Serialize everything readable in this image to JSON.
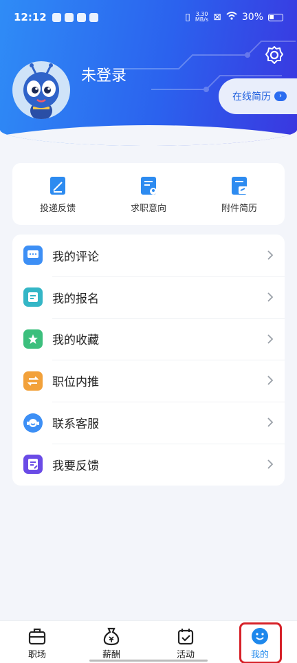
{
  "status_bar": {
    "time": "12:12",
    "net_speed_top": "3.30",
    "net_speed_bottom": "MB/s",
    "battery": "30%"
  },
  "header": {
    "username": "未登录",
    "resume_button": "在线简历",
    "accent": "#2b62ee"
  },
  "quick_actions": [
    {
      "label": "投递反馈",
      "icon": "edit-doc-icon"
    },
    {
      "label": "求职意向",
      "icon": "profile-doc-icon"
    },
    {
      "label": "附件简历",
      "icon": "attachment-folder-icon"
    }
  ],
  "menu": [
    {
      "label": "我的评论",
      "icon": "comment-icon",
      "color": "#3d8ff5"
    },
    {
      "label": "我的报名",
      "icon": "form-icon",
      "color": "#34b6c6"
    },
    {
      "label": "我的收藏",
      "icon": "star-icon",
      "color": "#3cbf7d"
    },
    {
      "label": "职位内推",
      "icon": "swap-icon",
      "color": "#f2a13a"
    },
    {
      "label": "联系客服",
      "icon": "service-icon",
      "color": "#3d8ff5"
    },
    {
      "label": "我要反馈",
      "icon": "feedback-icon",
      "color": "#6a4be6"
    }
  ],
  "tabs": [
    {
      "label": "职场",
      "icon": "briefcase-icon"
    },
    {
      "label": "薪酬",
      "icon": "money-bag-icon"
    },
    {
      "label": "活动",
      "icon": "calendar-check-icon"
    },
    {
      "label": "我的",
      "icon": "smile-icon",
      "active": true
    }
  ]
}
